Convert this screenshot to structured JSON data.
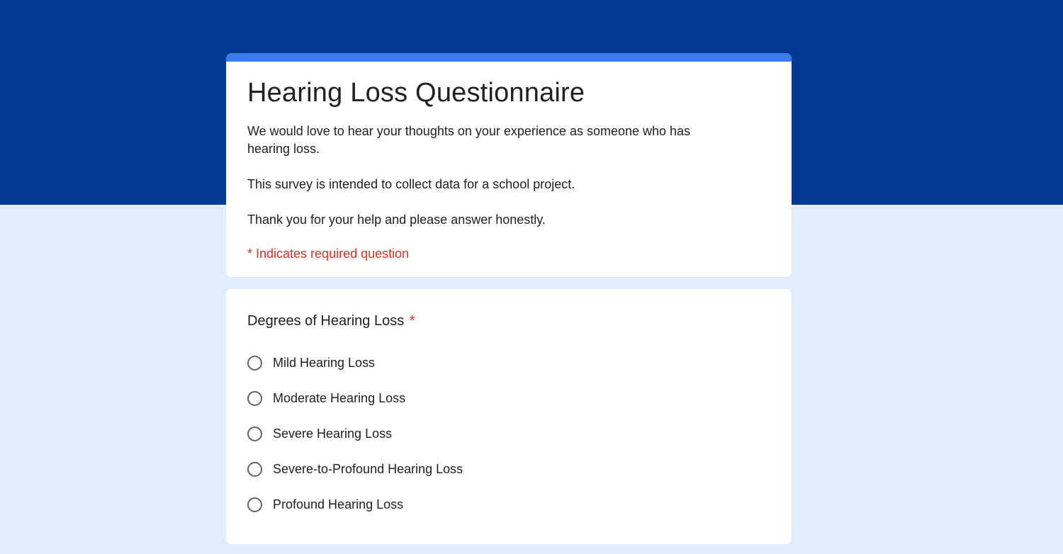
{
  "colors": {
    "banner": "#003894",
    "page_background": "#e3ecfb",
    "accent_bar": "#3a7ce8",
    "required": "#d93025"
  },
  "form": {
    "title": "Hearing Loss Questionnaire",
    "description": [
      "We would love to hear your thoughts on your experience as someone who has hearing loss.",
      "This survey is intended to collect data for a school project.",
      "Thank you for your help and please answer honestly."
    ],
    "required_note": "* Indicates required question"
  },
  "question": {
    "title": "Degrees of Hearing Loss",
    "required_marker": "*",
    "options": [
      {
        "label": "Mild Hearing Loss",
        "selected": false
      },
      {
        "label": "Moderate Hearing Loss",
        "selected": false
      },
      {
        "label": "Severe Hearing Loss",
        "selected": false
      },
      {
        "label": "Severe-to-Profound Hearing Loss",
        "selected": false
      },
      {
        "label": "Profound Hearing Loss",
        "selected": false
      }
    ]
  }
}
